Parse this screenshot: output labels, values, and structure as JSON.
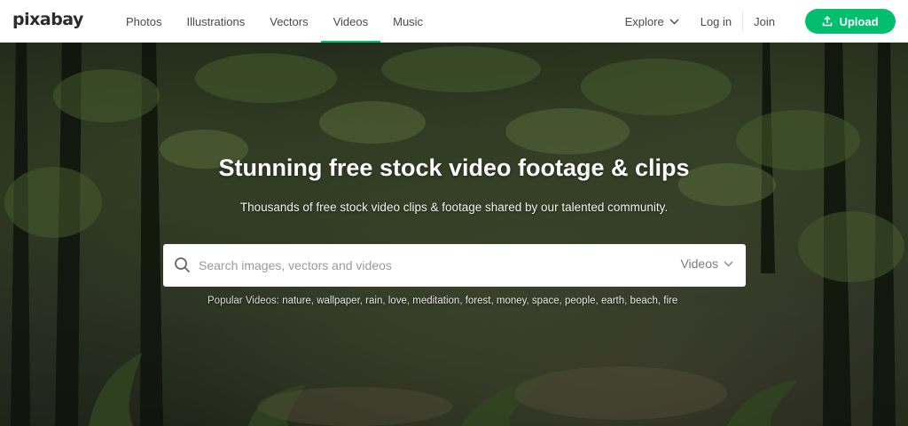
{
  "logo": "pixabay",
  "nav": {
    "items": [
      "Photos",
      "Illustrations",
      "Vectors",
      "Videos",
      "Music"
    ],
    "active": "Videos"
  },
  "right_nav": {
    "explore": "Explore",
    "login": "Log in",
    "join": "Join",
    "upload": "Upload"
  },
  "hero": {
    "title": "Stunning free stock video footage & clips",
    "subtitle": "Thousands of free stock video clips & footage shared by our talented community."
  },
  "search": {
    "placeholder": "Search images, vectors and videos",
    "type_selected": "Videos"
  },
  "popular": {
    "label": "Popular Videos:",
    "tags": [
      "nature",
      "wallpaper",
      "rain",
      "love",
      "meditation",
      "forest",
      "money",
      "space",
      "people",
      "earth",
      "beach",
      "fire"
    ]
  },
  "colors": {
    "accent": "#02be6e",
    "nav_text": "#4a4a4a",
    "topbar_bg": "#ffffff"
  },
  "icons": {
    "search": "search-icon",
    "upload": "upload-icon",
    "chevron": "chevron-down-icon"
  }
}
